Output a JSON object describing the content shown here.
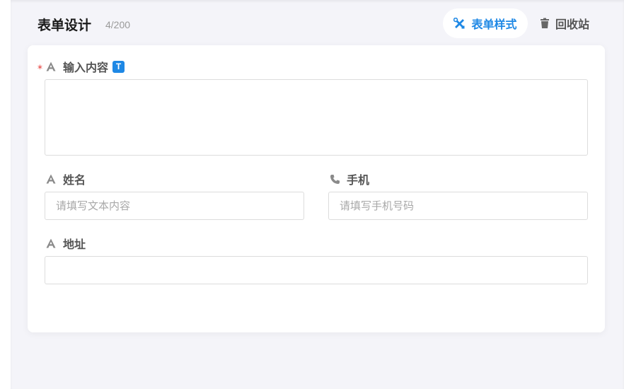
{
  "header": {
    "title": "表单设计",
    "count": "4/200",
    "style_button": "表单样式",
    "recycle_button": "回收站"
  },
  "form": {
    "content_field": {
      "label": "输入内容",
      "required_mark": "*",
      "badge": "T",
      "value": ""
    },
    "name_field": {
      "label": "姓名",
      "placeholder": "请填写文本内容"
    },
    "phone_field": {
      "label": "手机",
      "placeholder": "请填写手机号码"
    },
    "address_field": {
      "label": "地址",
      "placeholder": ""
    }
  },
  "colors": {
    "accent": "#1e88e5",
    "required": "#e53935",
    "background": "#f4f4f9"
  }
}
